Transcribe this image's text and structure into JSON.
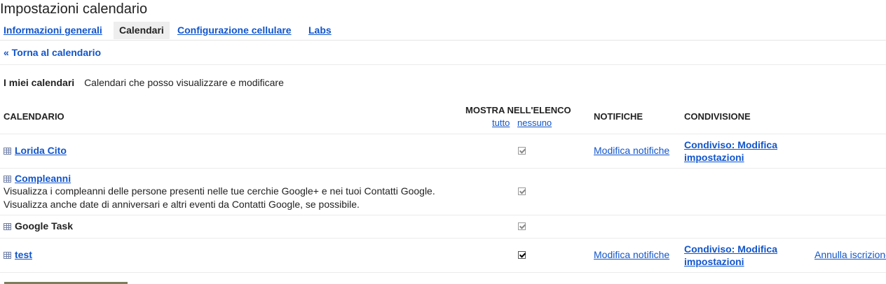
{
  "page": {
    "title": "Impostazioni calendario"
  },
  "tabs": [
    {
      "label": "Informazioni generali",
      "active": false
    },
    {
      "label": "Calendari",
      "active": true
    },
    {
      "label": "Configurazione cellulare",
      "active": false
    },
    {
      "label": "Labs",
      "active": false
    }
  ],
  "back_link": "« Torna al calendario",
  "section": {
    "heading": "I miei calendari",
    "subheading": "Calendari che posso visualizzare e modificare"
  },
  "columns": {
    "calendar": "CALENDARIO",
    "show_in_list": "MOSTRA NELL'ELENCO",
    "select_all": "tutto",
    "select_none": "nessuno",
    "notifications": "NOTIFICHE",
    "sharing": "CONDIVISIONE"
  },
  "rows": [
    {
      "name": "Lorida Cito",
      "is_link": true,
      "checked": true,
      "disabled": true,
      "notifications": "Modifica notifiche",
      "sharing": "Condiviso: Modifica impostazioni"
    },
    {
      "name": "Compleanni",
      "is_link": true,
      "desc_line1": "Visualizza i compleanni delle persone presenti nelle tue cerchie Google+ e nei tuoi Contatti Google.",
      "desc_line2": "Visualizza anche date di anniversari e altri eventi da Contatti Google, se possibile.",
      "checked": true,
      "disabled": true
    },
    {
      "name": "Google Task",
      "is_link": false,
      "checked": true,
      "disabled": true
    },
    {
      "name": "test",
      "is_link": true,
      "checked": true,
      "disabled": false,
      "notifications": "Modifica notifiche",
      "sharing": "Condiviso: Modifica impostazioni",
      "unsubscribe": "Annulla iscrizione"
    }
  ],
  "colors": {
    "link": "#1155cc",
    "text": "#222222",
    "divider": "#ebebeb"
  }
}
